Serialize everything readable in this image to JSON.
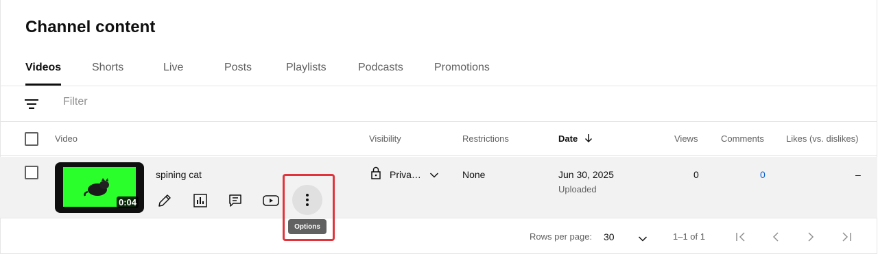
{
  "page": {
    "title": "Channel content"
  },
  "tabs": [
    {
      "label": "Videos",
      "active": true
    },
    {
      "label": "Shorts"
    },
    {
      "label": "Live"
    },
    {
      "label": "Posts"
    },
    {
      "label": "Playlists"
    },
    {
      "label": "Podcasts"
    },
    {
      "label": "Promotions"
    }
  ],
  "filter": {
    "placeholder": "Filter",
    "icon": "filter-icon"
  },
  "table": {
    "headers": {
      "video": "Video",
      "visibility": "Visibility",
      "restrictions": "Restrictions",
      "date": "Date",
      "views": "Views",
      "comments": "Comments",
      "likes": "Likes (vs. dislikes)"
    },
    "sort_icon": "arrow-down-icon",
    "rows": [
      {
        "title": "spining cat",
        "duration": "0:04",
        "visibility": "Priva…",
        "restrictions": "None",
        "date": "Jun 30, 2025",
        "date_status": "Uploaded",
        "views": "0",
        "comments": "0",
        "likes": "–",
        "actions": [
          "edit-icon",
          "analytics-icon",
          "comments-icon",
          "youtube-icon",
          "more-vert-icon"
        ]
      }
    ]
  },
  "tooltip": {
    "text": "Options"
  },
  "footer": {
    "rows_per_page_label": "Rows per page:",
    "rows_per_page_value": "30",
    "range": "1–1 of 1"
  },
  "colors": {
    "accent_blue": "#065fd4",
    "highlight_red": "#e0333a",
    "thumb_green": "#2bff2b"
  }
}
